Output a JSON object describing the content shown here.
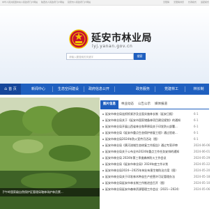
{
  "topbar": {
    "links": [
      "中华人民共和国中央人民政府门户网站",
      "陕西省人民政府门户网站",
      "延安市人民政府门户网站"
    ],
    "right_links": [
      "无障碍",
      "无障碍浏览",
      "长者模式",
      "适配模式"
    ]
  },
  "header": {
    "site_title": "延安市林业局",
    "site_domain": "lyj.yanan.gov.cn",
    "search_placeholder": "请输入要搜索的关键字",
    "search_button": "搜索"
  },
  "nav": {
    "items": [
      "首 页",
      "新闻中心",
      "生态空间建设",
      "政府信息公开",
      "政务服务",
      "党建林工",
      "林长制"
    ]
  },
  "photo": {
    "caption": "子午岭国家级自然保护区管理局辖林场护林员累..."
  },
  "news": {
    "tabs": [
      "图片信息",
      "林业动态",
      "公告公示",
      "媒体报道"
    ],
    "items": [
      {
        "title": "延安市林业局连抓抓紧涉及全面实施林长制（延安日报）",
        "date": "6-1"
      },
      {
        "title": "延安市林业局关于《延安市国家储备林项目建设规划》的通知",
        "date": "6-1"
      },
      {
        "title": "延安市林业局开展山西省林业和草原局关于印发防火部署...",
        "date": "6-1"
      },
      {
        "title": "延安市林业局《延安市重点生态保护修复工程》通过验收...",
        "date": "6-1"
      },
      {
        "title": "延安市林业局2024年防火宣传月活动（图）",
        "date": "6-1"
      },
      {
        "title": "延安市林业局《黄河流域生态修复工作报告》通过专家评审",
        "date": "2024-06-06"
      },
      {
        "title": "延安市林业局关于公布全市2024年重点工作任务安排的通知",
        "date": "2024-06-01"
      },
      {
        "title": "延安市林业局 2024年第三季度森林防火工作会议",
        "date": "2024-05-29"
      },
      {
        "title": "延安市林业局《延安市林业局》2024年度工作计划",
        "date": "2024-05-22"
      },
      {
        "title": "延安市林业局2024—2025年林业有害生物防治方案（图）",
        "date": "2024-05-20"
      },
      {
        "title": "延安市林业局关于印发林木种苗生产经营许可证管理办法",
        "date": "2024-05-18"
      },
      {
        "title": "延安市林业局延安市林长制工作推进会召开（图）",
        "date": "2024-05-10"
      },
      {
        "title": "延安市林业局延安市森林资源管理工作会议（2021—2024）",
        "date": "2024-05-06"
      }
    ]
  },
  "colors": {
    "primary": "#1f5fbf",
    "nav_active": "#16469a",
    "emblem_red": "#c8102e",
    "emblem_gold": "#f2c200"
  },
  "icons": {
    "emblem": "national-emblem-icon",
    "home": "home-icon"
  }
}
